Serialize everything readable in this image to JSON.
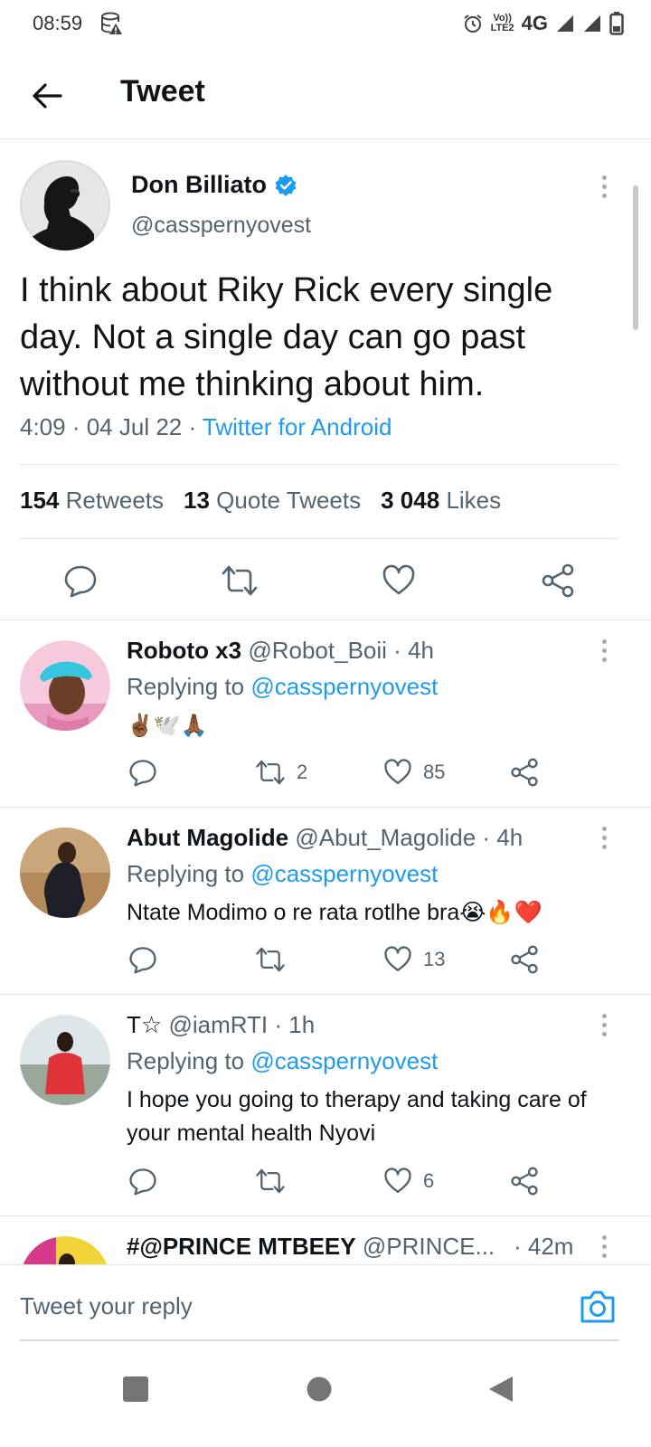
{
  "status_bar": {
    "time": "08:59",
    "volte_top": "Vo))",
    "volte_bottom": "LTE2",
    "network": "4G"
  },
  "header": {
    "title": "Tweet"
  },
  "main_tweet": {
    "name": "Don Billiato",
    "handle": "@casspernyovest",
    "text": "I think about Riky Rick every single day. Not a single day can go past without me thinking about him.",
    "time": "4:09",
    "date": "04 Jul 22",
    "source": "Twitter for Android",
    "retweets_count": "154",
    "retweets_label": "Retweets",
    "quotes_count": "13",
    "quotes_label": "Quote Tweets",
    "likes_count": "3 048",
    "likes_label": "Likes"
  },
  "replies": [
    {
      "name": "Roboto x3",
      "handle": "@Robot_Boii",
      "time": "4h",
      "replying_label": "Replying to",
      "replying_to": "@casspernyovest",
      "text": "✌🏾🕊️🙏🏾",
      "retweets": "2",
      "likes": "85"
    },
    {
      "name": "Abut Magolide",
      "handle": "@Abut_Magolide",
      "time": "4h",
      "replying_label": "Replying to",
      "replying_to": "@casspernyovest",
      "text": "Ntate Modimo o re rata rotlhe bra😭🔥❤️",
      "retweets": "",
      "likes": "13"
    },
    {
      "name": "T☆",
      "handle": "@iamRTI",
      "time": "1h",
      "replying_label": "Replying to",
      "replying_to": "@casspernyovest",
      "text": "I hope you going to therapy and taking care of your mental health Nyovi",
      "retweets": "",
      "likes": "6"
    },
    {
      "name": "#@PRINCE MTBEEY",
      "handle": "@PRINCE...",
      "time": "42m"
    }
  ],
  "reply_bar": {
    "placeholder": "Tweet your reply"
  },
  "colors": {
    "accent": "#1d9bf0",
    "secondary_text": "#536471",
    "divider": "#e2e5e8"
  }
}
